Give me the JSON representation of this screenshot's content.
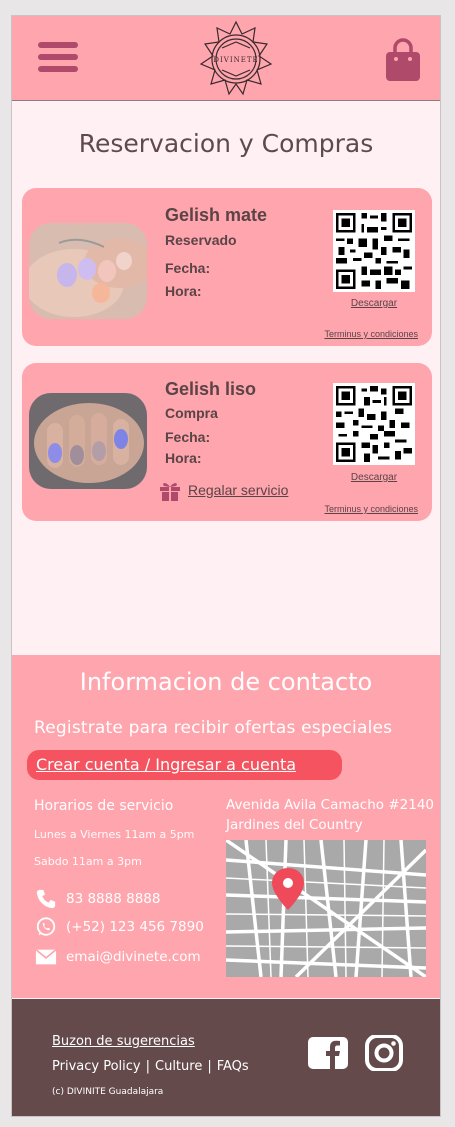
{
  "header": {
    "logo_text": "DIVINETE"
  },
  "page": {
    "title": "Reservacion y Compras"
  },
  "cards": [
    {
      "name": "Gelish mate",
      "status": "Reservado",
      "fecha_label": "Fecha:",
      "hora_label": "Hora:",
      "download_label": "Descargar",
      "terms_label": "Terminus y condiciones"
    },
    {
      "name": "Gelish liso",
      "status": "Compra",
      "fecha_label": "Fecha:",
      "hora_label": "Hora:",
      "download_label": "Descargar",
      "terms_label": "Terminus y condiciones",
      "gift_label": "Regalar servicio"
    }
  ],
  "contact": {
    "title": "Informacion de contacto",
    "promo": "Registrate para recibir ofertas especiales",
    "cta": "Crear cuenta / Ingresar a cuenta",
    "hours_title": "Horarios de servicio",
    "hours_weekday": "Lunes a Viernes 11am a 5pm",
    "hours_saturday": "Sabdo 11am a 3pm",
    "phone": "83 8888 8888",
    "whatsapp": "(+52) 123 456 7890",
    "email": "emai@divinete.com",
    "address_line1": "Avenida Avila Camacho #2140",
    "address_line2": "Jardines del Country"
  },
  "footer": {
    "suggestions": "Buzon de sugerencias",
    "privacy": "Privacy Policy",
    "culture": "Culture",
    "faqs": "FAQs",
    "sep": "|",
    "copyright": "(c) DIVINITE Guadalajara"
  },
  "colors": {
    "brand_pink": "#ffa5ae",
    "page_bg": "#fff0f3",
    "accent_red": "#f4535f",
    "footer_brown": "#654a4c",
    "icon_berry": "#b04a6a"
  }
}
